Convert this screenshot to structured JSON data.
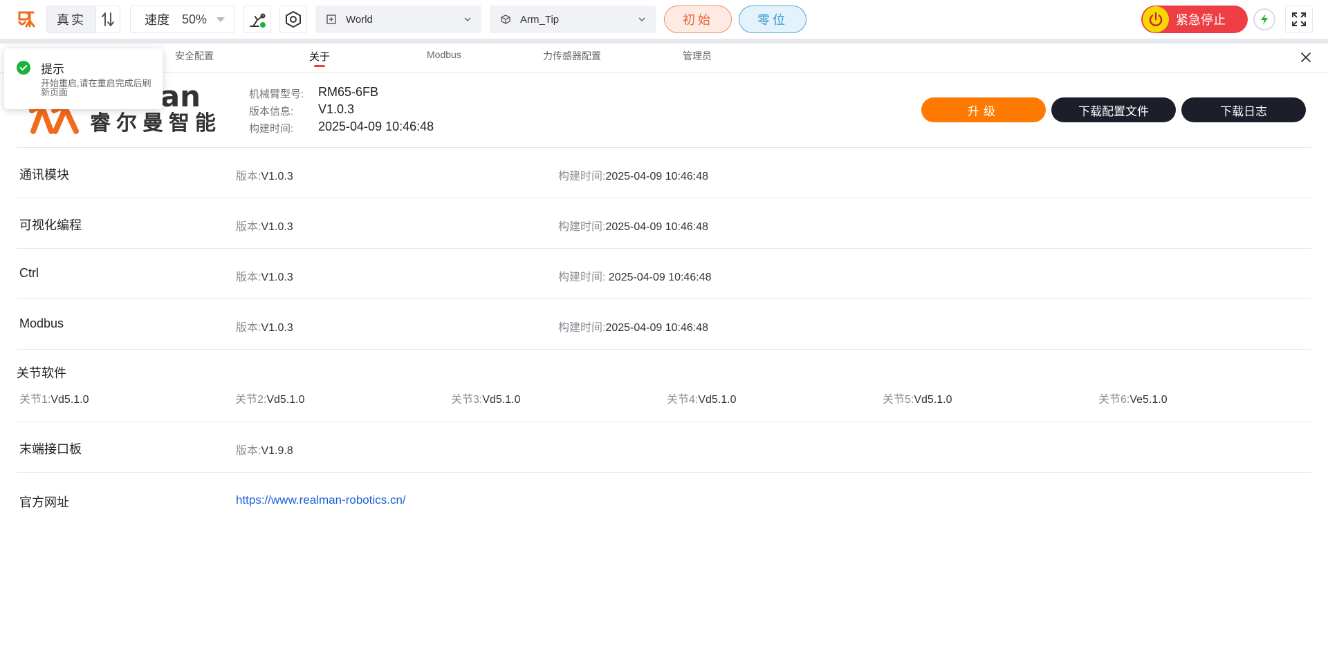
{
  "toolbar": {
    "mode_label": "真实",
    "speed_label": "速度",
    "speed_value": "50%",
    "frame_select": "World",
    "tool_select": "Arm_Tip",
    "init_button": "初始",
    "zero_button": "零位",
    "estop_label": "紧急停止"
  },
  "tabs": {
    "safety": "安全配置",
    "about": "关于",
    "modbus": "Modbus",
    "force_sensor": "力传感器配置",
    "admin": "管理员"
  },
  "toast": {
    "title": "提示",
    "message": "开始重启,请在重启完成后刷新页面"
  },
  "logo": {
    "brand_latin": "man",
    "brand_cn": "睿尔曼智能"
  },
  "device": {
    "model_label": "机械臂型号:",
    "model_value": "RM65-6FB",
    "version_label": "版本信息:",
    "version_value": "V1.0.3",
    "build_label": "构建时间:",
    "build_value": "2025-04-09 10:46:48"
  },
  "actions": {
    "upgrade": "升级",
    "download_config": "下载配置文件",
    "download_log": "下载日志"
  },
  "modules": [
    {
      "name": "通讯模块",
      "version_label": "版本:",
      "version": "V1.0.3",
      "build_label": "构建时间:",
      "build": "2025-04-09 10:46:48"
    },
    {
      "name": "可视化编程",
      "version_label": "版本:",
      "version": "V1.0.3",
      "build_label": "构建时间:",
      "build": "2025-04-09 10:46:48"
    },
    {
      "name": "Ctrl",
      "version_label": "版本:",
      "version": "V1.0.3",
      "build_label": "构建时间:",
      "build": " 2025-04-09 10:46:48"
    },
    {
      "name": "Modbus",
      "version_label": "版本:",
      "version": "V1.0.3",
      "build_label": "构建时间:",
      "build": "2025-04-09 10:46:48"
    }
  ],
  "joints": {
    "title": "关节软件",
    "items": [
      {
        "label": "关节1:",
        "value": "Vd5.1.0"
      },
      {
        "label": "关节2:",
        "value": "Vd5.1.0"
      },
      {
        "label": "关节3:",
        "value": "Vd5.1.0"
      },
      {
        "label": "关节4:",
        "value": "Vd5.1.0"
      },
      {
        "label": "关节5:",
        "value": "Vd5.1.0"
      },
      {
        "label": "关节6:",
        "value": "Ve5.1.0"
      }
    ]
  },
  "end_board": {
    "name": "末端接口板",
    "version_label": "版本:",
    "version": "V1.9.8"
  },
  "website": {
    "name": "官方网址",
    "url": "https://www.realman-robotics.cn/"
  },
  "colors": {
    "accent_orange": "#ff7a00",
    "estop_red": "#ee3e44",
    "dark_button": "#1c1f2a",
    "link_blue": "#1a5fd6",
    "success_green": "#19b33b"
  },
  "icons": [
    "brand-logo-icon",
    "swap-icon",
    "robot-arm-icon",
    "hexagon-settings-icon",
    "frame-icon",
    "cube-icon",
    "chevron-down-icon",
    "power-icon",
    "lightning-icon",
    "fullscreen-icon",
    "close-icon",
    "check-circle-icon"
  ]
}
